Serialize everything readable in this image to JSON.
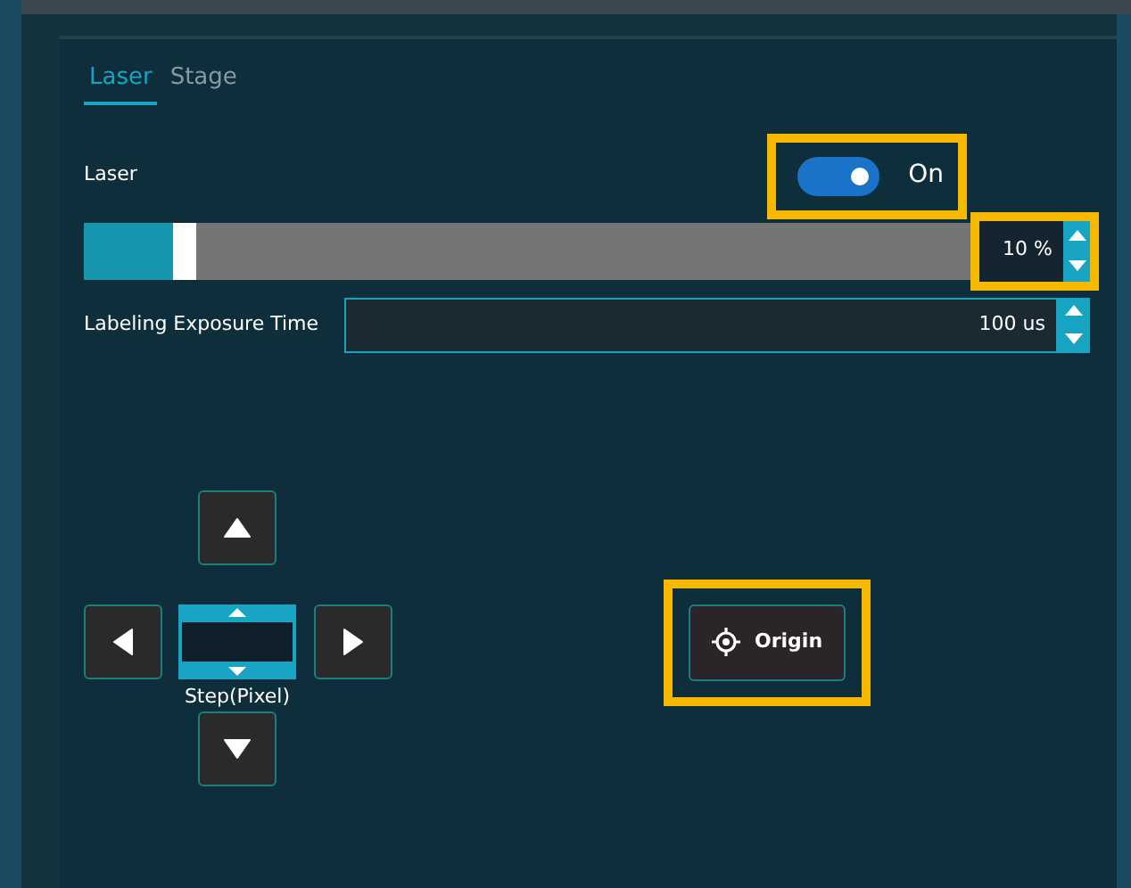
{
  "tabs": [
    {
      "label": "Laser",
      "selected": true
    },
    {
      "label": "Stage",
      "selected": false
    }
  ],
  "laser": {
    "label": "Laser",
    "on": true,
    "state_text": "On",
    "highlighted": true
  },
  "power": {
    "level": 0.1,
    "reading": "10 %",
    "highlighted": true
  },
  "exposure": {
    "label": "Labeling Exposure Time",
    "value": "100 us"
  },
  "stage": {
    "step_label": "Step(Pixel)"
  },
  "origin": {
    "label": "Origin",
    "highlighted": true
  }
}
